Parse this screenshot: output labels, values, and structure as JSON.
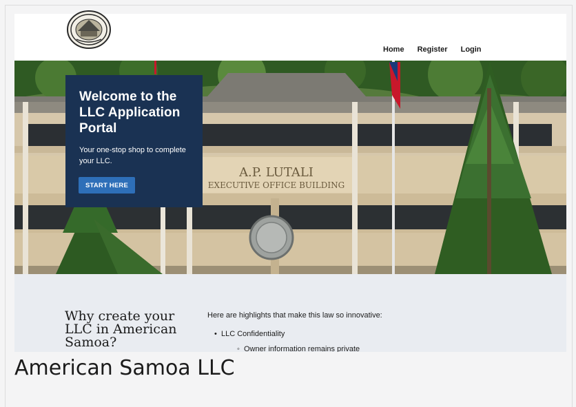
{
  "header": {
    "logo_alt": "American Samoa government seal",
    "nav": [
      {
        "label": "Home"
      },
      {
        "label": "Register"
      },
      {
        "label": "Login"
      }
    ]
  },
  "hero": {
    "building_sign_line1": "A.P. LUTALI",
    "building_sign_line2": "EXECUTIVE OFFICE BUILDING",
    "card": {
      "title": "Welcome to the LLC Application Portal",
      "subtitle": "Your one-stop shop to complete your LLC.",
      "cta_label": "START HERE"
    }
  },
  "highlights": {
    "heading": "Why create your LLC in American Samoa?",
    "intro": "Here are highlights that make this law so innovative:",
    "items": [
      {
        "label": "LLC Confidentiality",
        "sub": [
          "Owner information remains private"
        ]
      }
    ]
  },
  "footer": {
    "title": "American Samoa LLC"
  },
  "colors": {
    "card_bg": "#1a3253",
    "button_bg": "#2e6fb8",
    "section_bg": "#e9ecf1"
  }
}
